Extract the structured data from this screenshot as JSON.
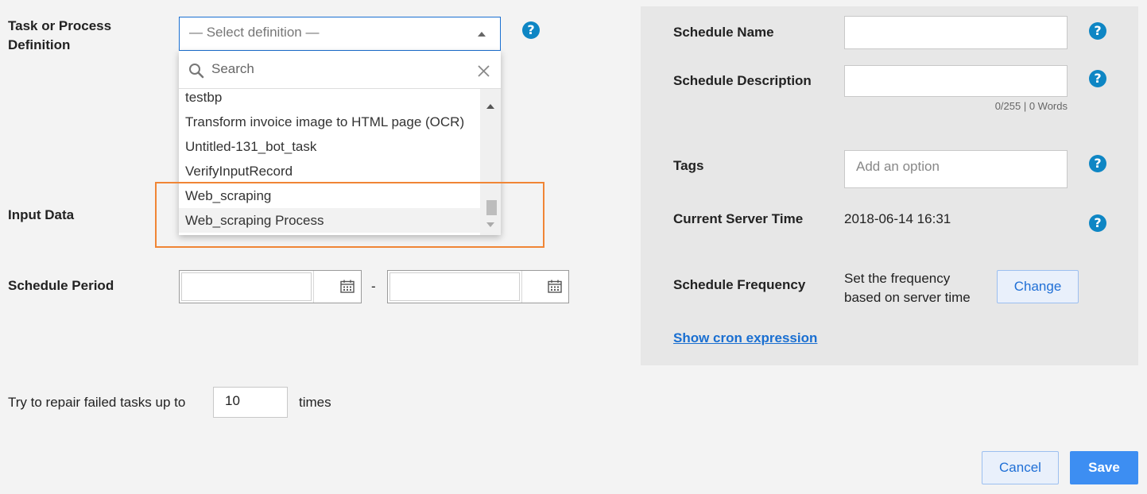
{
  "form": {
    "definition_label": "Task or Process Definition",
    "definition_placeholder": "— Select definition —",
    "input_data_label": "Input Data",
    "schedule_period_label": "Schedule Period",
    "period_separator": "-",
    "repair_prefix": "Try to repair failed tasks up to",
    "repair_value": "10",
    "repair_suffix": "times"
  },
  "dropdown": {
    "search_placeholder": "Search",
    "items": [
      "testbp",
      "Transform invoice image to HTML page (OCR)",
      "Untitled-131_bot_task",
      "VerifyInputRecord",
      "Web_scraping",
      "Web_scraping Process"
    ]
  },
  "right_panel": {
    "schedule_name_label": "Schedule Name",
    "schedule_description_label": "Schedule Description",
    "char_counter": "0/255 | 0 Words",
    "tags_label": "Tags",
    "tags_placeholder": "Add an option",
    "server_time_label": "Current Server Time",
    "server_time_value": "2018-06-14 16:31",
    "frequency_label": "Schedule Frequency",
    "frequency_hint_line1": "Set the frequency",
    "frequency_hint_line2": "based on server time",
    "change_label": "Change",
    "cron_link": "Show cron expression"
  },
  "footer": {
    "cancel_label": "Cancel",
    "save_label": "Save"
  },
  "icons": {
    "help": "help-circle-icon",
    "search": "search-icon",
    "clear": "close-icon",
    "calendar": "calendar-icon"
  },
  "colors": {
    "accent": "#1a6fd1",
    "help_blue": "#0e86c4",
    "highlight_orange": "#f08535",
    "save_blue": "#3d8ef2"
  }
}
